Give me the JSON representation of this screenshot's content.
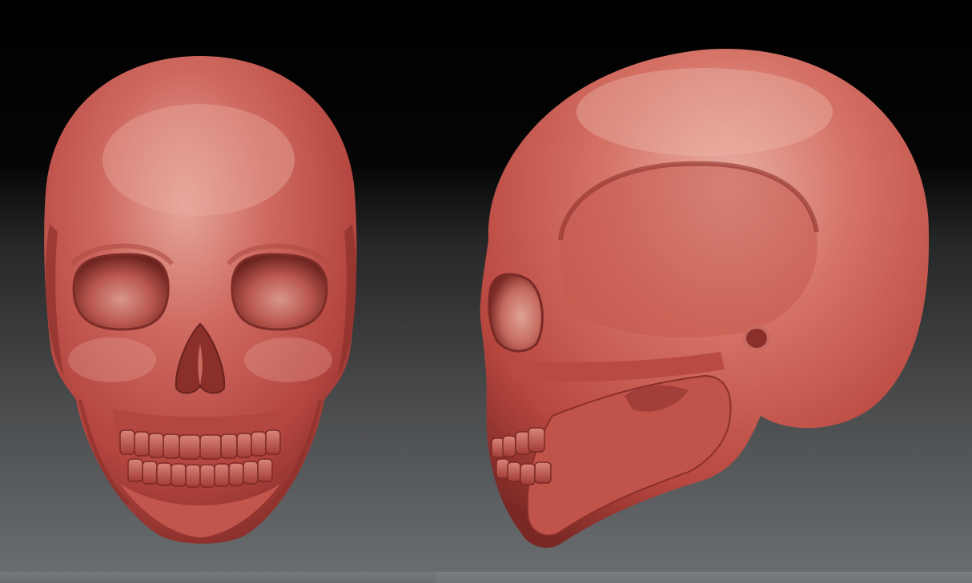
{
  "scene": {
    "background_top": "#000000",
    "background_bottom": "#6c6f72",
    "material_color": "#c0504a",
    "material_highlight": "#e39a90",
    "material_shadow": "#7a2a26"
  },
  "views": [
    {
      "name": "front-view",
      "subject": "skull"
    },
    {
      "name": "side-view",
      "subject": "skull"
    }
  ]
}
